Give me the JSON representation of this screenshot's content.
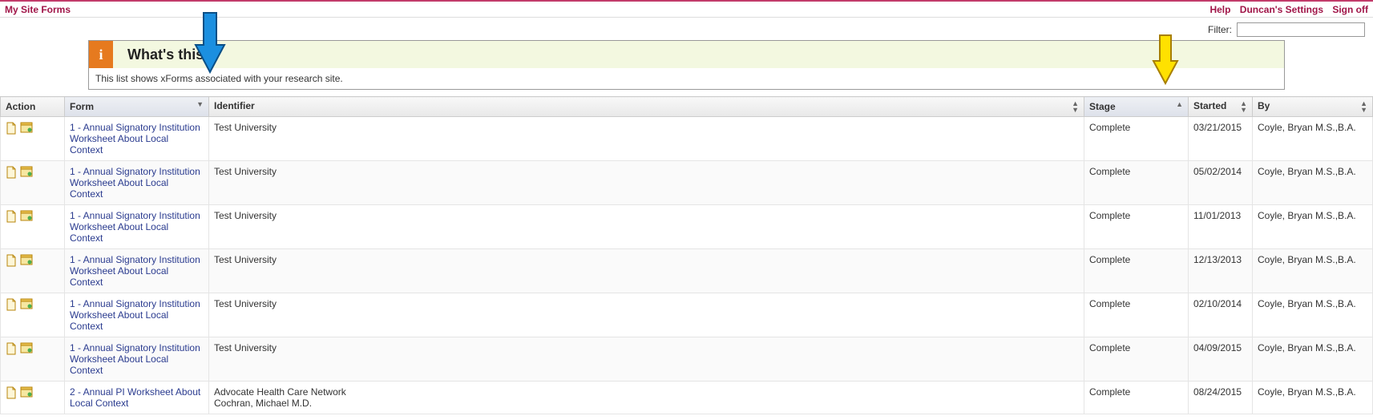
{
  "topbar": {
    "left_link": "My Site Forms",
    "help": "Help",
    "settings": "Duncan's Settings",
    "signoff": "Sign off"
  },
  "filter": {
    "label": "Filter:",
    "value": ""
  },
  "whats": {
    "badge": "i",
    "title": "What's this?",
    "body": "This list shows xForms associated with your research site."
  },
  "columns": {
    "action": "Action",
    "form": "Form",
    "identifier": "Identifier",
    "stage": "Stage",
    "started": "Started",
    "by": "By"
  },
  "rows": [
    {
      "form": "1 - Annual Signatory Institution Worksheet About Local Context",
      "identifier": "Test University",
      "stage": "Complete",
      "started": "03/21/2015",
      "by": "Coyle, Bryan M.S.,B.A."
    },
    {
      "form": "1 - Annual Signatory Institution Worksheet About Local Context",
      "identifier": "Test University",
      "stage": "Complete",
      "started": "05/02/2014",
      "by": "Coyle, Bryan M.S.,B.A."
    },
    {
      "form": "1 - Annual Signatory Institution Worksheet About Local Context",
      "identifier": "Test University",
      "stage": "Complete",
      "started": "11/01/2013",
      "by": "Coyle, Bryan M.S.,B.A."
    },
    {
      "form": "1 - Annual Signatory Institution Worksheet About Local Context",
      "identifier": "Test University",
      "stage": "Complete",
      "started": "12/13/2013",
      "by": "Coyle, Bryan M.S.,B.A."
    },
    {
      "form": "1 - Annual Signatory Institution Worksheet About Local Context",
      "identifier": "Test University",
      "stage": "Complete",
      "started": "02/10/2014",
      "by": "Coyle, Bryan M.S.,B.A."
    },
    {
      "form": "1 - Annual Signatory Institution Worksheet About Local Context",
      "identifier": "Test University",
      "stage": "Complete",
      "started": "04/09/2015",
      "by": "Coyle, Bryan M.S.,B.A."
    },
    {
      "form": "2 - Annual PI Worksheet About Local Context",
      "identifier": "Advocate Health Care Network\nCochran, Michael M.D.",
      "stage": "Complete",
      "started": "08/24/2015",
      "by": "Coyle, Bryan M.S.,B.A."
    }
  ]
}
